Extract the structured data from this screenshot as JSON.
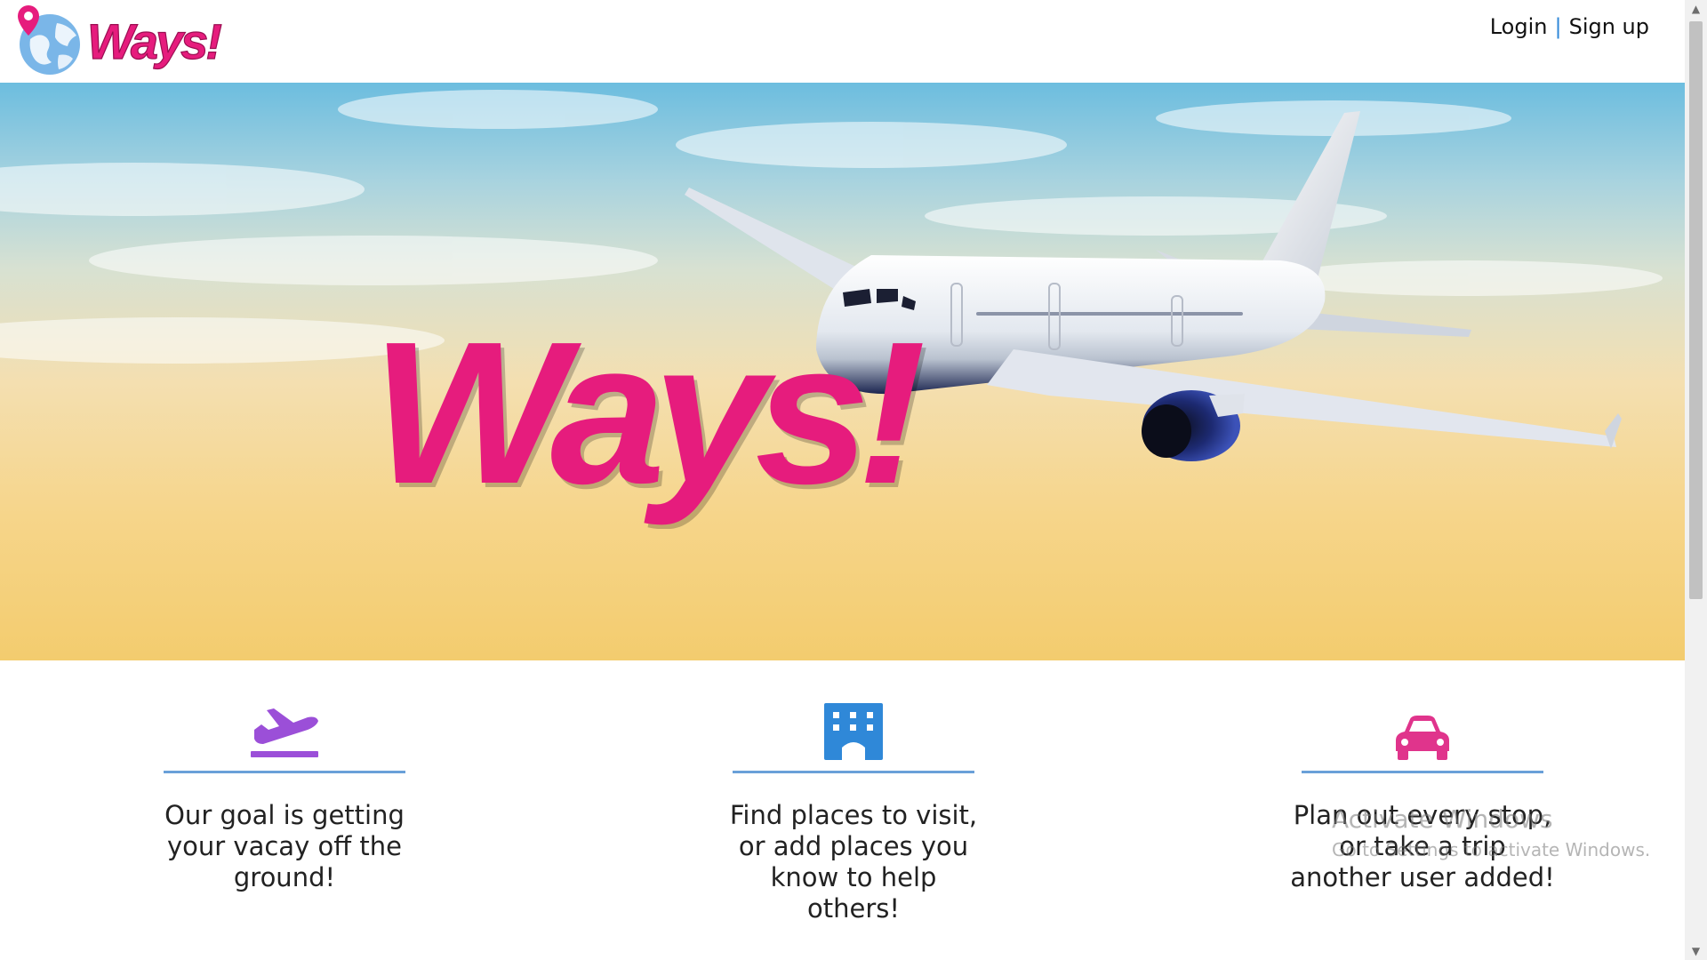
{
  "header": {
    "logo_text": "Ways!",
    "login_label": "Login",
    "separator": "|",
    "signup_label": "Sign up"
  },
  "hero": {
    "title": "Ways!"
  },
  "features": [
    {
      "icon": "plane-departure-icon",
      "text": "Our goal is getting your vacay off the ground!"
    },
    {
      "icon": "hotel-icon",
      "text": "Find places to visit, or add places you know to help others!"
    },
    {
      "icon": "car-icon",
      "text": "Plan out every stop, or take a trip another user added!"
    }
  ],
  "watermark": {
    "line1": "Activate Windows",
    "line2": "Go to Settings to activate Windows."
  },
  "colors": {
    "brand_pink": "#e61c7d",
    "accent_blue": "#6aa0d8",
    "plane_icon": "#9b4fd8",
    "hotel_icon": "#2f88d8",
    "car_icon": "#e0348c"
  }
}
